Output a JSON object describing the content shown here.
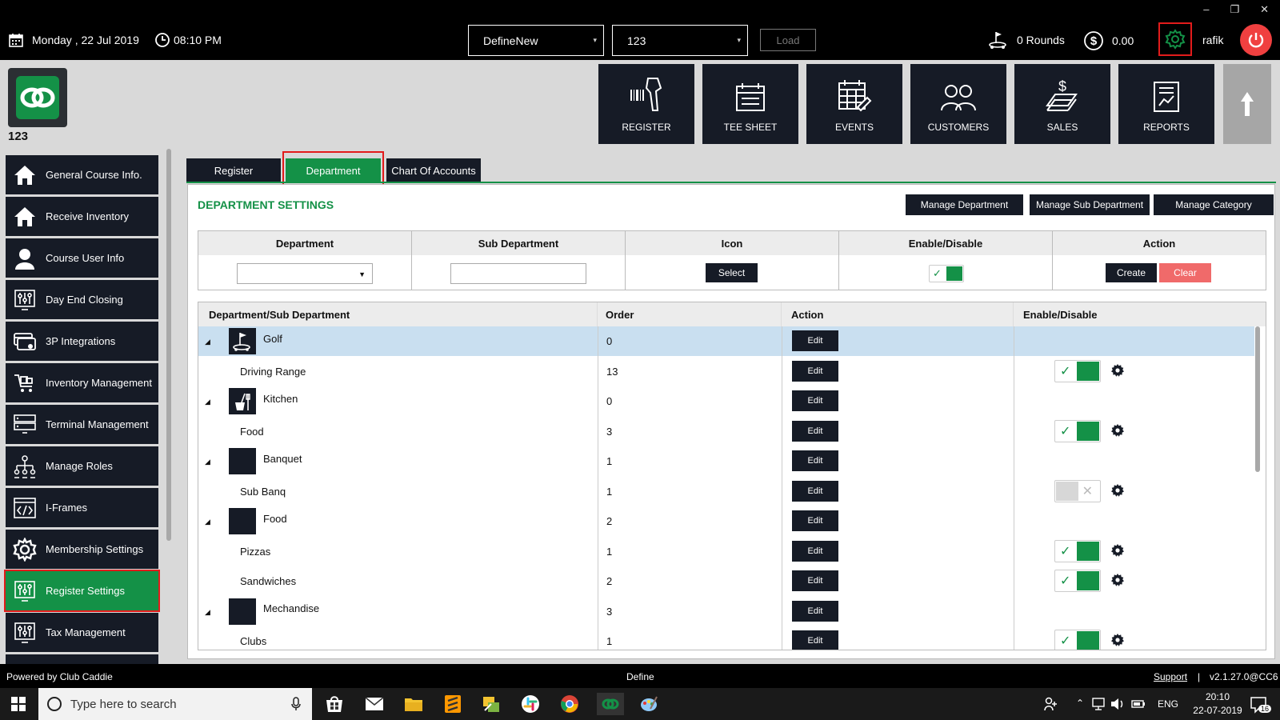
{
  "topbar": {
    "date": "Monday ,  22 Jul 2019",
    "time": "08:10 PM",
    "dropdown1": "DefineNew",
    "dropdown2": "123",
    "load_label": "Load",
    "rounds": "0 Rounds",
    "amount": "0.00",
    "user": "rafik",
    "window_controls": [
      "–",
      "❐",
      "✕"
    ]
  },
  "header": {
    "course_number": "123",
    "nav": [
      "REGISTER",
      "TEE SHEET",
      "EVENTS",
      "CUSTOMERS",
      "SALES",
      "REPORTS"
    ]
  },
  "sidebar": {
    "items": [
      {
        "label": "General Course Info.",
        "icon": "home-icon"
      },
      {
        "label": "Receive Inventory",
        "icon": "home-icon"
      },
      {
        "label": "Course User Info",
        "icon": "user-icon"
      },
      {
        "label": "Day End Closing",
        "icon": "sliders-icon"
      },
      {
        "label": "3P Integrations",
        "icon": "card-icon"
      },
      {
        "label": "Inventory Management",
        "icon": "cart-icon"
      },
      {
        "label": "Terminal Management",
        "icon": "server-icon"
      },
      {
        "label": "Manage Roles",
        "icon": "hierarchy-icon"
      },
      {
        "label": "I-Frames",
        "icon": "code-icon"
      },
      {
        "label": "Membership Settings",
        "icon": "gear-icon"
      },
      {
        "label": "Register Settings",
        "icon": "sliders-icon",
        "active": true
      },
      {
        "label": "Tax Management",
        "icon": "sliders-icon"
      }
    ]
  },
  "tabs": [
    "Register",
    "Department",
    "Chart Of Accounts"
  ],
  "settings": {
    "title": "DEPARTMENT SETTINGS",
    "buttons": [
      "Manage Department",
      "Manage Sub Department",
      "Manage Category"
    ]
  },
  "form": {
    "headers": [
      "Department",
      "Sub Department",
      "Icon",
      "Enable/Disable",
      "Action"
    ],
    "select_label": "Select",
    "create_label": "Create",
    "clear_label": "Clear",
    "enabled": true
  },
  "grid": {
    "headers": [
      "Department/Sub Department",
      "Order",
      "Action",
      "Enable/Disable"
    ],
    "edit_label": "Edit",
    "rows": [
      {
        "name": "Golf",
        "order": "0",
        "parent": true,
        "selected": true,
        "icon": "golf-icon"
      },
      {
        "name": "Driving Range",
        "order": "13",
        "parent": false,
        "toggle": "on"
      },
      {
        "name": "Kitchen",
        "order": "0",
        "parent": true,
        "icon": "kitchen-icon"
      },
      {
        "name": "Food",
        "order": "3",
        "parent": false,
        "toggle": "on"
      },
      {
        "name": "Banquet",
        "order": "1",
        "parent": true
      },
      {
        "name": "Sub Banq",
        "order": "1",
        "parent": false,
        "toggle": "off"
      },
      {
        "name": "Food",
        "order": "2",
        "parent": true
      },
      {
        "name": "Pizzas",
        "order": "1",
        "parent": false,
        "toggle": "on"
      },
      {
        "name": "Sandwiches",
        "order": "2",
        "parent": false,
        "toggle": "on"
      },
      {
        "name": "Mechandise",
        "order": "3",
        "parent": true
      },
      {
        "name": "Clubs",
        "order": "1",
        "parent": false,
        "toggle": "on"
      }
    ]
  },
  "footer": {
    "powered": "Powered by Club Caddie",
    "center": "Define",
    "support": "Support",
    "separator": "|",
    "version": "v2.1.27.0@CC6"
  },
  "taskbar": {
    "search_placeholder": "Type here to search",
    "lang": "ENG",
    "clock_time": "20:10",
    "clock_date": "22-07-2019",
    "notifications": "16"
  },
  "colors": {
    "accent_green": "#149147",
    "dark_tile": "#161b26",
    "highlight_red": "#e21b1b"
  }
}
